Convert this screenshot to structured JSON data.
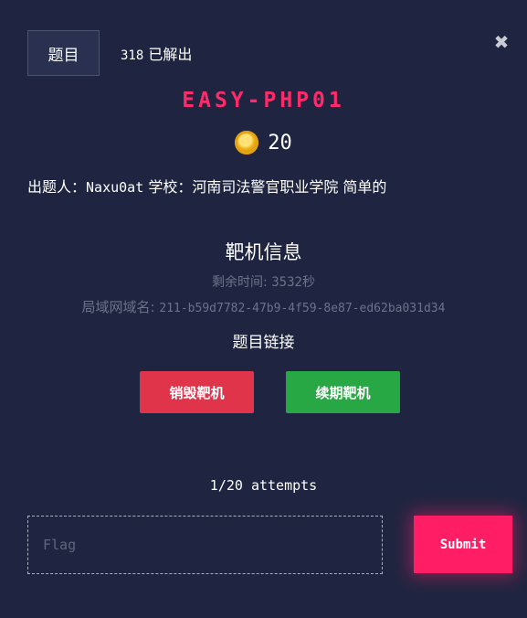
{
  "header": {
    "tab_label": "题目",
    "solved_count": "318",
    "solved_label": " 已解出",
    "close_glyph": "✖"
  },
  "challenge": {
    "title": "EASY-PHP01",
    "points": "20",
    "author_label": "出题人：",
    "author": "Naxu0at",
    "school_label": " 学校：",
    "school": "河南司法警官职业学院",
    "difficulty": " 简单的"
  },
  "target": {
    "section_title": "靶机信息",
    "remaining_label": "剩余时间: ",
    "remaining_value": "3532",
    "remaining_unit": "秒",
    "domain_label": "局域网域名: ",
    "domain_value": "211-b59d7782-47b9-4f59-8e87-ed62ba031d34",
    "link_label": "题目链接",
    "destroy_button": "销毁靶机",
    "renew_button": "续期靶机"
  },
  "submission": {
    "attempts": "1/20 attempts",
    "flag_placeholder": "Flag",
    "submit_label": "Submit"
  },
  "colors": {
    "background": "#1f2540",
    "title": "#ff2a6a",
    "destroy": "#e0344a",
    "renew": "#28a745",
    "submit": "#ff1e66"
  },
  "icons": {
    "points": "coin-icon",
    "close": "close-icon"
  }
}
